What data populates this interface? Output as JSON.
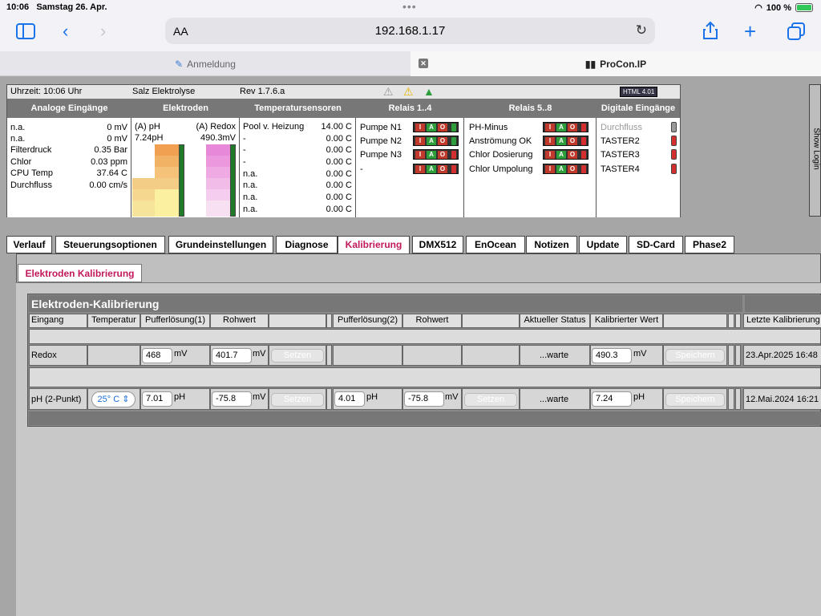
{
  "statusbar": {
    "time": "10:06",
    "date": "Samstag 26. Apr.",
    "battery": "100 %"
  },
  "browser": {
    "aa": "AA",
    "url": "192.168.1.17",
    "tabs": [
      {
        "label": "Anmeldung"
      },
      {
        "label": "ProCon.IP"
      }
    ]
  },
  "header": {
    "time": "Uhrzeit: 10:06 Uhr",
    "title": "Salz Elektrolyse",
    "rev": "Rev 1.7.6.a",
    "badge": "HTML 4.01",
    "columns": [
      "Analoge Eingänge",
      "Elektroden",
      "Temperatursensoren",
      "Relais 1..4",
      "Relais 5..8",
      "Digitale Eingänge"
    ],
    "analog": [
      {
        "name": "n.a.",
        "value": "0 mV"
      },
      {
        "name": "n.a.",
        "value": "0 mV"
      },
      {
        "name": "Filterdruck",
        "value": "0.35 Bar"
      },
      {
        "name": "Chlor",
        "value": "0.03 ppm"
      },
      {
        "name": "CPU Temp",
        "value": "37.64 C"
      },
      {
        "name": "Durchfluss",
        "value": "0.00 cm/s"
      }
    ],
    "electrodes": {
      "ph_label": "(A) pH",
      "ph_value": "7.24pH",
      "redox_label": "(A) Redox",
      "redox_value": "490.3mV"
    },
    "temps": [
      {
        "name": "Pool v. Heizung",
        "value": "14.00 C"
      },
      {
        "name": "-",
        "value": "0.00 C"
      },
      {
        "name": "-",
        "value": "0.00 C"
      },
      {
        "name": "-",
        "value": "0.00 C"
      },
      {
        "name": "n.a.",
        "value": "0.00 C"
      },
      {
        "name": "n.a.",
        "value": "0.00 C"
      },
      {
        "name": "n.a.",
        "value": "0.00 C"
      },
      {
        "name": "n.a.",
        "value": "0.00 C"
      }
    ],
    "relays1": [
      "Pumpe N1",
      "Pumpe N2",
      "Pumpe N3",
      "-"
    ],
    "relays2": [
      "PH-Minus",
      "Anströmung OK",
      "Chlor Dosierung",
      "Chlor Umpolung"
    ],
    "digital": [
      "Durchfluss",
      "TASTER2",
      "TASTER3",
      "TASTER4"
    ],
    "iao": {
      "i": "I",
      "a": "A",
      "o": "O"
    },
    "show_login": "Show Login"
  },
  "tabs": [
    "Verlauf",
    "Steuerungsoptionen",
    "Grundeinstellungen",
    "Diagnose",
    "Kalibrierung",
    "DMX512",
    "EnOcean",
    "Notizen",
    "Update",
    "SD-Card",
    "Phase2"
  ],
  "subtab": "Elektroden Kalibrierung",
  "calib": {
    "title": "Elektroden-Kalibrierung",
    "headers": [
      "Eingang",
      "Temperatur",
      "Pufferlösung(1)",
      "Rohwert",
      "Pufferlösung(2)",
      "Rohwert",
      "Aktueller Status",
      "Kalibrierter Wert",
      "Letzte Kalibrierung"
    ],
    "rows": [
      {
        "name": "Redox",
        "temp": "",
        "buf1": "468",
        "unit1": "mV",
        "raw1": "401.7",
        "rawunit1": "mV",
        "set1": "Setzen",
        "buf2": "",
        "raw2": "",
        "status": "...warte",
        "calval": "490.3",
        "calunit": "mV",
        "save": "Speichern",
        "last": "23.Apr.2025 16:48"
      },
      {
        "name": "pH (2-Punkt)",
        "temp": "25° C",
        "buf1": "7.01",
        "unit1": "pH",
        "raw1": "-75.8",
        "rawunit1": "mV",
        "set1": "Setzen",
        "buf2": "4.01",
        "unit2": "pH",
        "raw2": "-75.8",
        "rawunit2": "mV",
        "set2": "Setzen",
        "status": "...warte",
        "calval": "7.24",
        "calunit": "pH",
        "save": "Speichern",
        "last": "12.Mai.2024 16:21"
      }
    ]
  }
}
